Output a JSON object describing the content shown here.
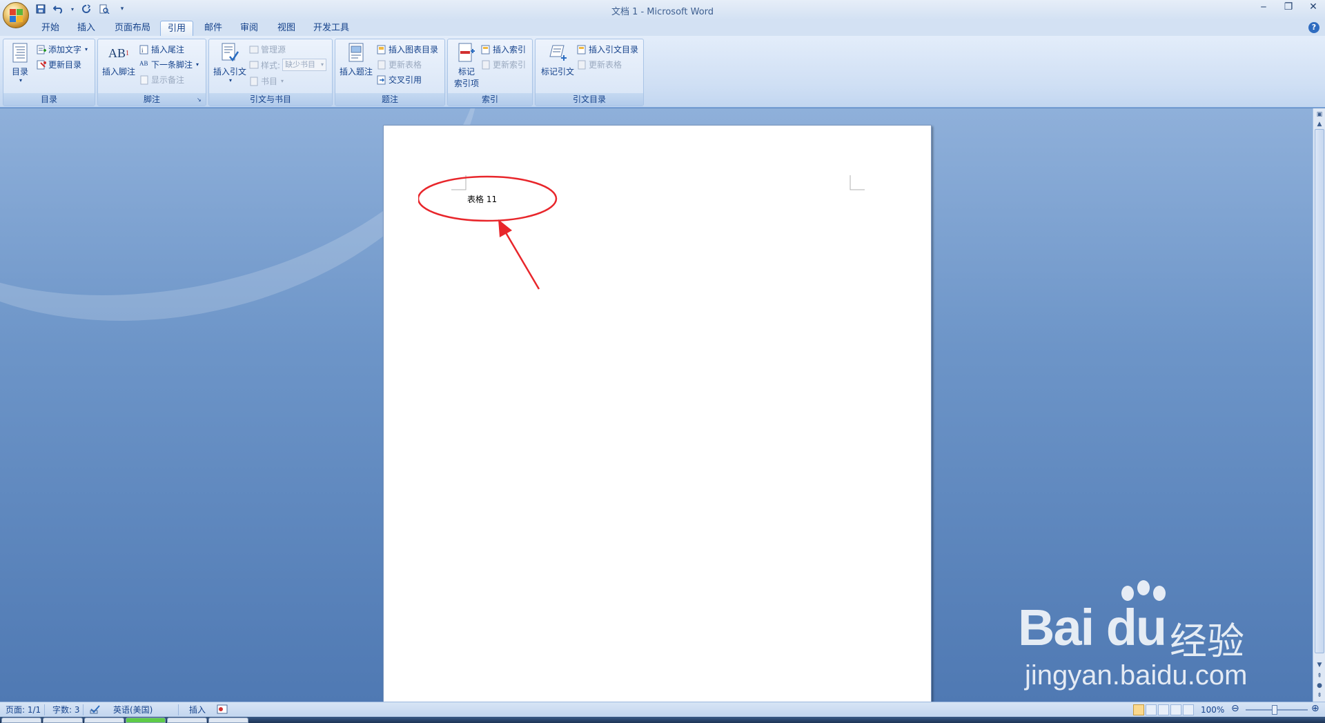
{
  "window": {
    "title": "文档 1 - Microsoft Word",
    "controls": [
      "‒",
      "❐",
      "✕"
    ]
  },
  "quick_access": {
    "save_icon": "save-icon",
    "undo_icon": "undo-icon",
    "redo_icon": "redo-icon",
    "print_preview_icon": "print-preview-icon",
    "customize": "▾"
  },
  "tabs": [
    {
      "label": "开始"
    },
    {
      "label": "插入"
    },
    {
      "label": "页面布局"
    },
    {
      "label": "引用",
      "active": true
    },
    {
      "label": "邮件"
    },
    {
      "label": "审阅"
    },
    {
      "label": "视图"
    },
    {
      "label": "开发工具"
    }
  ],
  "ribbon": {
    "toc": {
      "group_label": "目录",
      "toc_button": "目录",
      "add_text": "添加文字",
      "update_toc": "更新目录"
    },
    "footnotes": {
      "group_label": "脚注",
      "insert_footnote": "插入脚注",
      "insert_endnote": "插入尾注",
      "next_footnote": "下一条脚注",
      "show_notes": "显示备注"
    },
    "citations": {
      "group_label": "引文与书目",
      "insert_citation": "插入引文",
      "manage_sources": "管理源",
      "style_label": "样式:",
      "style_value": "缺少书目",
      "bibliography": "书目"
    },
    "captions": {
      "group_label": "题注",
      "insert_caption": "插入题注",
      "insert_table_of_figures": "插入图表目录",
      "update_table": "更新表格",
      "cross_reference": "交叉引用"
    },
    "index": {
      "group_label": "索引",
      "mark_entry_line1": "标记",
      "mark_entry_line2": "索引项",
      "insert_index": "插入索引",
      "update_index": "更新索引"
    },
    "table_of_authorities": {
      "group_label": "引文目录",
      "mark_citation": "标记引文",
      "insert_toa": "插入引文目录",
      "update_table": "更新表格"
    }
  },
  "document": {
    "caption": "表格 11"
  },
  "annotation": {
    "color": "#e8262b"
  },
  "watermark": {
    "brand": "Bai du",
    "brand_cn": "经验",
    "url": "jingyan.baidu.com"
  },
  "status": {
    "page": "页面: 1/1",
    "words": "字数: 3",
    "language": "英语(美国)",
    "mode": "插入",
    "zoom": "100%",
    "zoom_out": "⊖",
    "zoom_in": "⊕"
  }
}
